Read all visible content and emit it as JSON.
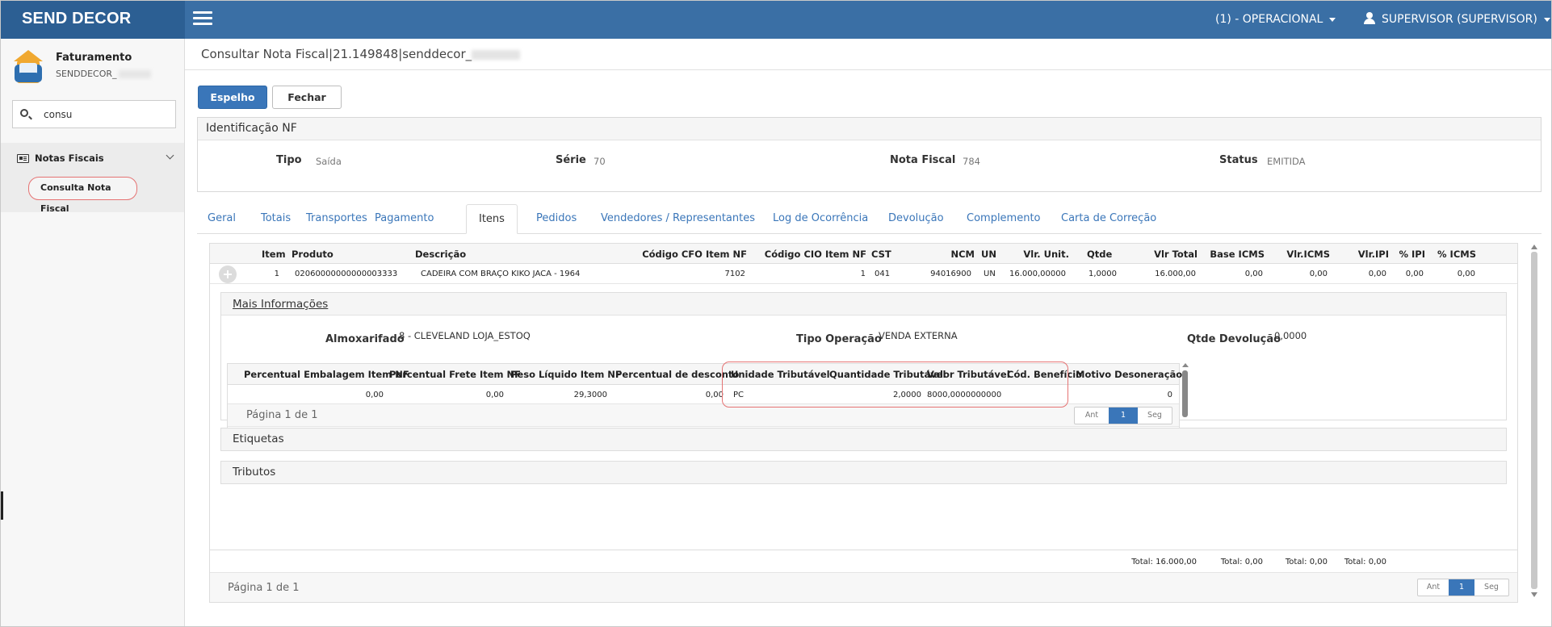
{
  "app": {
    "brand": "SEND DECOR"
  },
  "topbar": {
    "operation": "(1) - OPERACIONAL",
    "user": "SUPERVISOR (SUPERVISOR)"
  },
  "sidebar": {
    "module_title": "Faturamento",
    "module_sub": "SENDDECOR_",
    "search_value": "consu",
    "group_label": "Notas Fiscais",
    "item_label": "Consulta Nota Fiscal"
  },
  "page": {
    "title": "Consultar Nota Fiscal|21.149848|senddecor_"
  },
  "buttons": {
    "espelho": "Espelho",
    "fechar": "Fechar"
  },
  "identificacao": {
    "title": "Identificação NF",
    "tipo_label": "Tipo",
    "tipo_value": "Saída",
    "serie_label": "Série",
    "serie_value": "70",
    "nota_label": "Nota Fiscal",
    "nota_value": "784",
    "status_label": "Status",
    "status_value": "EMITIDA"
  },
  "tabs": [
    "Geral",
    "Totais",
    "Transportes",
    "Pagamento",
    "Itens",
    "Pedidos",
    "Vendedores / Representantes",
    "Log de Ocorrência",
    "Devolução",
    "Complemento",
    "Carta de Correção"
  ],
  "items_grid": {
    "headers": [
      "Item",
      "Produto",
      "Descrição",
      "Código CFO Item NF",
      "Código CIO Item NF",
      "CST",
      "NCM",
      "UN",
      "Vlr. Unit.",
      "Qtde",
      "Vlr Total",
      "Base ICMS",
      "Vlr.ICMS",
      "Vlr.IPI",
      "% IPI",
      "% ICMS"
    ],
    "row": [
      "1",
      "02060000000000003333",
      "CADEIRA COM BRAÇO KIKO JACA - 1964",
      "7102",
      "1",
      "041",
      "94016900",
      "UN",
      "16.000,00000",
      "1,0000",
      "16.000,00",
      "0,00",
      "0,00",
      "0,00",
      "0,00",
      "0,00"
    ],
    "totals": [
      "Total: 16.000,00",
      "Total: 0,00",
      "Total: 0,00",
      "Total: 0,00"
    ],
    "page_text": "Página 1 de 1",
    "pager": {
      "prev": "Ant",
      "current": "1",
      "next": "Seg"
    }
  },
  "mais_info": {
    "title": "Mais Informações",
    "almox_label": "Almoxarifado",
    "almox_value": "8 - CLEVELAND LOJA_ESTOQ",
    "tipo_op_label": "Tipo Operação",
    "tipo_op_value": "VENDA EXTERNA",
    "qtde_dev_label": "Qtde Devolução",
    "qtde_dev_value": "0,0000",
    "sub_headers": [
      "Percentual Embalagem Item NF",
      "Percentual Frete Item NF",
      "Peso Líquido Item NF",
      "Percentual de desconto",
      "Unidade Tributável",
      "Quantidade Tributável",
      "Valor Tributável",
      "Cód. Benefício",
      "Motivo Desoneração"
    ],
    "sub_row": [
      "0,00",
      "0,00",
      "29,3000",
      "0,00",
      "PC",
      "2,0000",
      "8000,0000000000",
      "",
      "0"
    ],
    "page_text": "Página 1 de 1",
    "pager": {
      "prev": "Ant",
      "current": "1",
      "next": "Seg"
    }
  },
  "accordions": {
    "etiquetas": "Etiquetas",
    "tributos": "Tributos"
  }
}
